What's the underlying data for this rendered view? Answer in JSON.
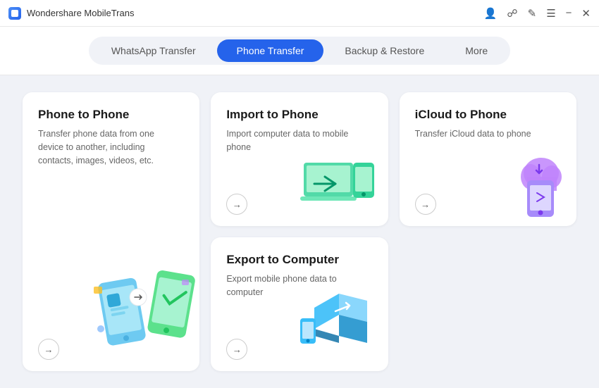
{
  "titleBar": {
    "appName": "Wondershare MobileTrans",
    "icons": [
      "user-icon",
      "bookmark-icon",
      "edit-icon",
      "menu-icon",
      "minimize-icon",
      "close-icon"
    ]
  },
  "nav": {
    "tabs": [
      {
        "id": "whatsapp",
        "label": "WhatsApp Transfer",
        "active": false
      },
      {
        "id": "phone",
        "label": "Phone Transfer",
        "active": true
      },
      {
        "id": "backup",
        "label": "Backup & Restore",
        "active": false
      },
      {
        "id": "more",
        "label": "More",
        "active": false
      }
    ]
  },
  "cards": [
    {
      "id": "phone-to-phone",
      "title": "Phone to Phone",
      "desc": "Transfer phone data from one device to another, including contacts, images, videos, etc.",
      "arrowLabel": "→",
      "size": "large"
    },
    {
      "id": "import-to-phone",
      "title": "Import to Phone",
      "desc": "Import computer data to mobile phone",
      "arrowLabel": "→",
      "size": "small"
    },
    {
      "id": "icloud-to-phone",
      "title": "iCloud to Phone",
      "desc": "Transfer iCloud data to phone",
      "arrowLabel": "→",
      "size": "small"
    },
    {
      "id": "export-to-computer",
      "title": "Export to Computer",
      "desc": "Export mobile phone data to computer",
      "arrowLabel": "→",
      "size": "small"
    }
  ]
}
